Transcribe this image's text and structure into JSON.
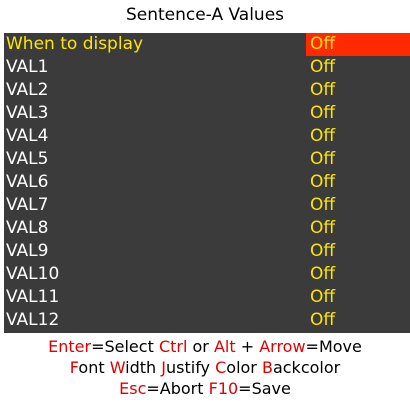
{
  "title": "Sentence-A Values",
  "rows": [
    {
      "label": "When to display",
      "value": "Off",
      "selected": true
    },
    {
      "label": "VAL1",
      "value": "Off"
    },
    {
      "label": "VAL2",
      "value": "Off"
    },
    {
      "label": "VAL3",
      "value": "Off"
    },
    {
      "label": "VAL4",
      "value": "Off"
    },
    {
      "label": "VAL5",
      "value": "Off"
    },
    {
      "label": "VAL6",
      "value": "Off"
    },
    {
      "label": "VAL7",
      "value": "Off"
    },
    {
      "label": "VAL8",
      "value": "Off"
    },
    {
      "label": "VAL9",
      "value": "Off"
    },
    {
      "label": "VAL10",
      "value": "Off"
    },
    {
      "label": "VAL11",
      "value": "Off"
    },
    {
      "label": "VAL12",
      "value": "Off"
    }
  ],
  "help": {
    "line1": [
      {
        "text": "Enter",
        "key": true
      },
      {
        "text": "=Select ",
        "key": false
      },
      {
        "text": "Ctrl",
        "key": true
      },
      {
        "text": " or ",
        "key": false
      },
      {
        "text": "Alt",
        "key": true
      },
      {
        "text": " + ",
        "key": false
      },
      {
        "text": "Arrow",
        "key": true
      },
      {
        "text": "=Move",
        "key": false
      }
    ],
    "line2": [
      {
        "text": "F",
        "key": true
      },
      {
        "text": "ont ",
        "key": false
      },
      {
        "text": "W",
        "key": true
      },
      {
        "text": "idth ",
        "key": false
      },
      {
        "text": "J",
        "key": true
      },
      {
        "text": "ustify ",
        "key": false
      },
      {
        "text": "C",
        "key": true
      },
      {
        "text": "olor ",
        "key": false
      },
      {
        "text": "B",
        "key": true
      },
      {
        "text": "ackcolor",
        "key": false
      }
    ],
    "line3": [
      {
        "text": "Esc",
        "key": true
      },
      {
        "text": "=Abort ",
        "key": false
      },
      {
        "text": "F10",
        "key": true
      },
      {
        "text": "=Save",
        "key": false
      }
    ]
  },
  "colors": {
    "list_background": "#3b3b3b",
    "value_text": "#ffe600",
    "selection_highlight": "#ff2a00",
    "shortcut_key_text": "#e00000"
  }
}
